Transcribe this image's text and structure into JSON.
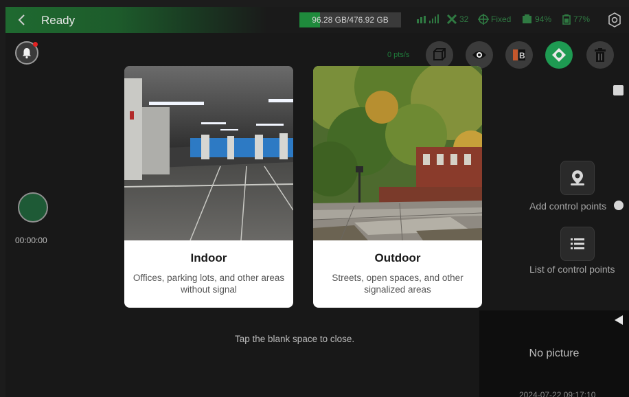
{
  "header": {
    "title": "Ready",
    "storage_text": "96.28 GB/476.92 GB",
    "storage_fraction": 0.2019,
    "satellites": "32",
    "fix_status": "Fixed",
    "battery_1": "94%",
    "battery_2": "77%"
  },
  "left": {
    "timer": "00:00:00"
  },
  "toolbar": {
    "rate": "0 pts/s"
  },
  "right_panel": {
    "add_control_points": "Add control points",
    "list_control_points": "List of control points",
    "no_picture": "No picture",
    "picture_timestamp": "2024-07-22 09:17:10"
  },
  "modal": {
    "indoor": {
      "title": "Indoor",
      "description": "Offices, parking lots, and other areas without signal"
    },
    "outdoor": {
      "title": "Outdoor",
      "description": "Streets, open spaces, and other signalized areas"
    },
    "hint": "Tap the blank space to close."
  },
  "colors": {
    "accent_green": "#1e9a52",
    "status_green": "#2f7a42",
    "alert_red": "#e32222"
  }
}
